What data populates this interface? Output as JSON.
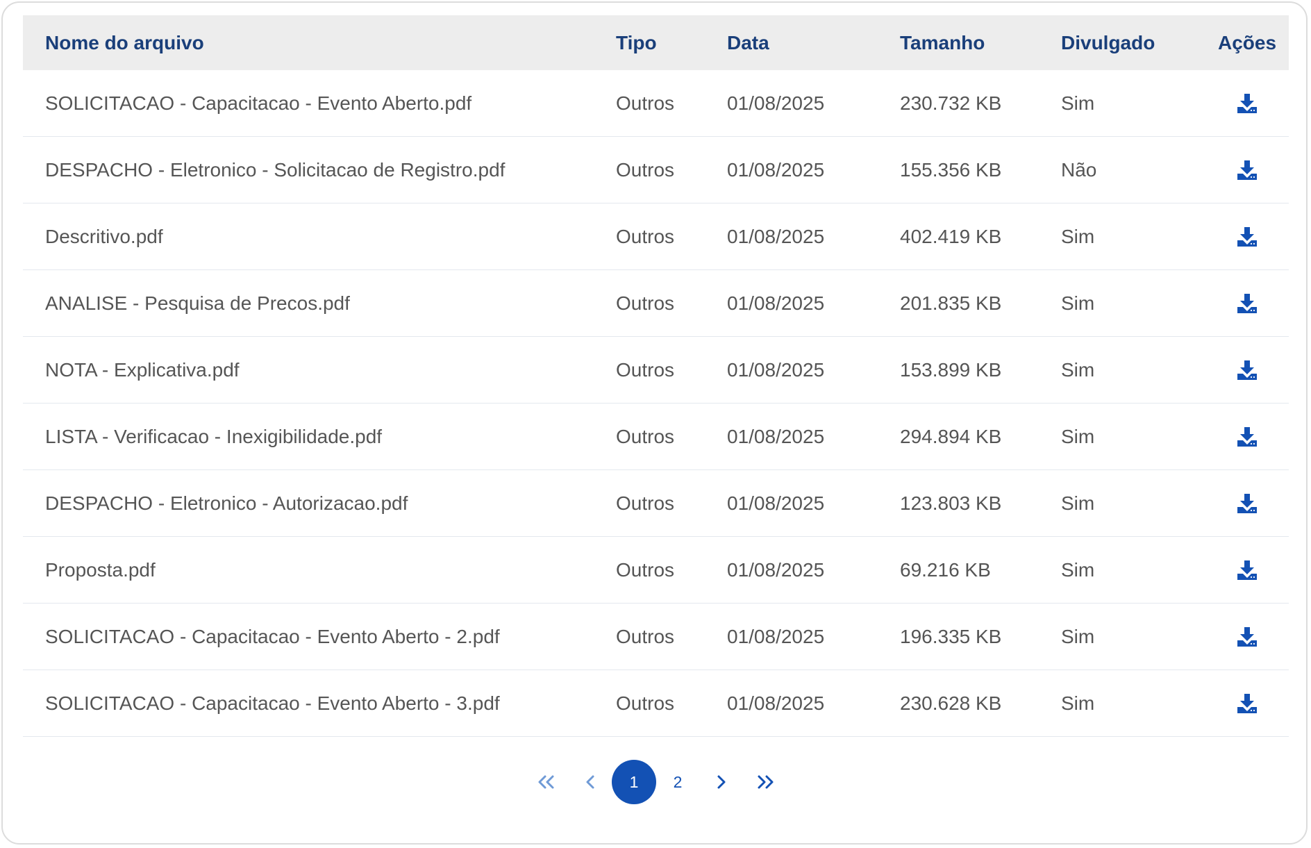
{
  "table": {
    "headers": {
      "name": "Nome do arquivo",
      "type": "Tipo",
      "date": "Data",
      "size": "Tamanho",
      "published": "Divulgado",
      "actions": "Ações"
    },
    "rows": [
      {
        "name": "SOLICITACAO - Capacitacao - Evento Aberto.pdf",
        "type": "Outros",
        "date": "01/08/2025",
        "size": "230.732 KB",
        "published": "Sim",
        "action_icon": "download-icon"
      },
      {
        "name": "DESPACHO - Eletronico - Solicitacao de Registro.pdf",
        "type": "Outros",
        "date": "01/08/2025",
        "size": "155.356 KB",
        "published": "Não",
        "action_icon": "download-icon"
      },
      {
        "name": "Descritivo.pdf",
        "type": "Outros",
        "date": "01/08/2025",
        "size": "402.419 KB",
        "published": "Sim",
        "action_icon": "download-icon"
      },
      {
        "name": "ANALISE - Pesquisa de Precos.pdf",
        "type": "Outros",
        "date": "01/08/2025",
        "size": "201.835 KB",
        "published": "Sim",
        "action_icon": "download-icon"
      },
      {
        "name": "NOTA - Explicativa.pdf",
        "type": "Outros",
        "date": "01/08/2025",
        "size": "153.899 KB",
        "published": "Sim",
        "action_icon": "download-icon"
      },
      {
        "name": "LISTA - Verificacao - Inexigibilidade.pdf",
        "type": "Outros",
        "date": "01/08/2025",
        "size": "294.894 KB",
        "published": "Sim",
        "action_icon": "download-icon"
      },
      {
        "name": "DESPACHO - Eletronico - Autorizacao.pdf",
        "type": "Outros",
        "date": "01/08/2025",
        "size": "123.803 KB",
        "published": "Sim",
        "action_icon": "download-icon"
      },
      {
        "name": "Proposta.pdf",
        "type": "Outros",
        "date": "01/08/2025",
        "size": "69.216 KB",
        "published": "Sim",
        "action_icon": "download-icon"
      },
      {
        "name": "SOLICITACAO - Capacitacao - Evento Aberto - 2.pdf",
        "type": "Outros",
        "date": "01/08/2025",
        "size": "196.335 KB",
        "published": "Sim",
        "action_icon": "download-icon"
      },
      {
        "name": "SOLICITACAO - Capacitacao - Evento Aberto - 3.pdf",
        "type": "Outros",
        "date": "01/08/2025",
        "size": "230.628 KB",
        "published": "Sim",
        "action_icon": "download-icon"
      }
    ]
  },
  "pagination": {
    "first_icon": "double-chevron-left-icon",
    "prev_icon": "chevron-left-icon",
    "pages": [
      "1",
      "2"
    ],
    "current_page": "1",
    "next_icon": "chevron-right-icon",
    "last_icon": "double-chevron-right-icon"
  },
  "colors": {
    "header_text": "#1a3f7a",
    "header_background": "#ededed",
    "cell_text": "#555555",
    "accent": "#1351b4",
    "pager_disabled": "#6f9ad6"
  }
}
